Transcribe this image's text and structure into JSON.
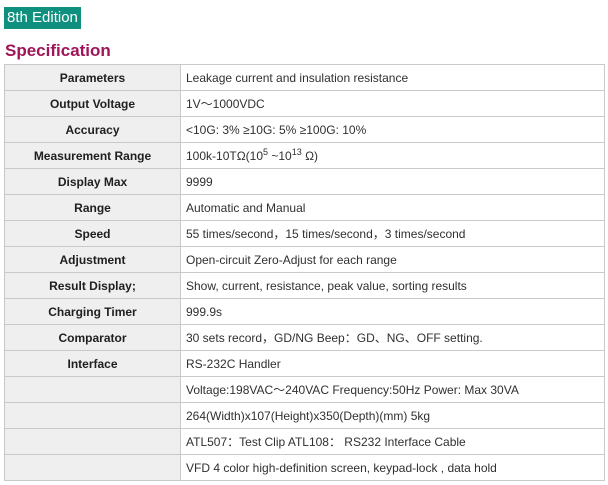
{
  "edition": "8th Edition",
  "section_title": "Specification",
  "spec_rows": [
    {
      "param": "Parameters",
      "value": "Leakage current and insulation resistance"
    },
    {
      "param": "Output Voltage",
      "value": "1V～1000VDC"
    },
    {
      "param": "Accuracy",
      "value": "<10G: 3% ≥10G: 5% ≥100G: 10%"
    },
    {
      "param": "Measurement Range",
      "value_prefix": "100k-10TΩ(10",
      "value_exp1": "5",
      "value_mid": " ~10",
      "value_exp2": "13",
      "value_suffix": " Ω)"
    },
    {
      "param": "Display Max",
      "value": "9999"
    },
    {
      "param": "Range",
      "value": "Automatic and Manual"
    },
    {
      "param": "Speed",
      "value": "55 times/second，15 times/second，3 times/second"
    },
    {
      "param": "Adjustment",
      "value": "Open-circuit Zero-Adjust for each range"
    },
    {
      "param": "Result Display;",
      "value": "Show, current, resistance, peak value, sorting results"
    },
    {
      "param": "Charging Timer",
      "value": "999.9s"
    },
    {
      "param": "Comparator",
      "value": "30 sets record，GD/NG Beep：GD、NG、OFF setting."
    },
    {
      "param": "Interface",
      "value": "RS-232C Handler"
    },
    {
      "param": "",
      "value": "Voltage:198VAC～240VAC Frequency:50Hz Power: Max 30VA"
    },
    {
      "param": "",
      "value": "264(Width)x107(Height)x350(Depth)(mm) 5kg"
    },
    {
      "param": "",
      "value": "ATL507：Test Clip ATL108： RS232 Interface Cable"
    },
    {
      "param": "",
      "value": "VFD 4 color high-definition screen, keypad-lock , data hold"
    }
  ]
}
